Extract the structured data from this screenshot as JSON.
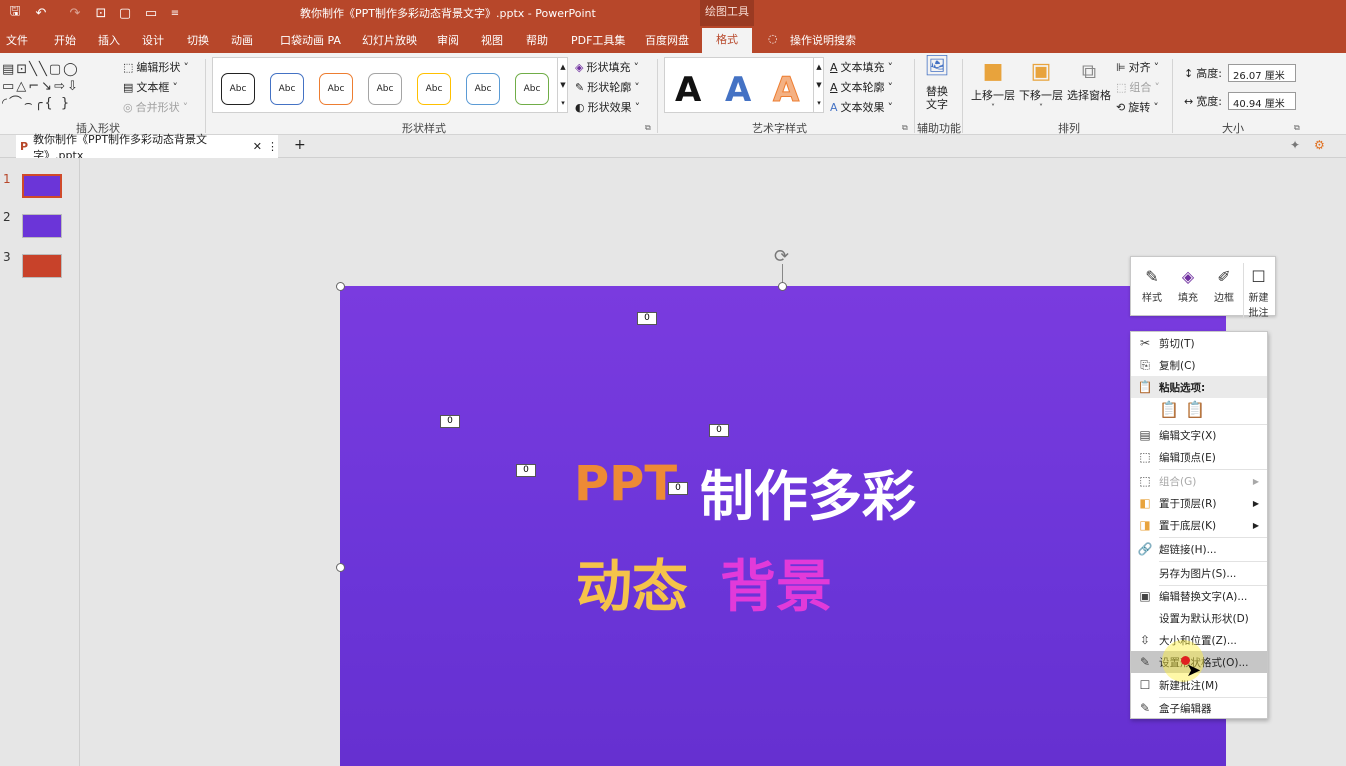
{
  "app": {
    "title": "教你制作《PPT制作多彩动态背景文字》.pptx  -  PowerPoint",
    "context_tools": "绘图工具",
    "accent": "#b7472a"
  },
  "tabs": [
    "文件",
    "开始",
    "插入",
    "设计",
    "切换",
    "动画",
    "口袋动画 PA",
    "幻灯片放映",
    "审阅",
    "视图",
    "帮助",
    "PDF工具集",
    "百度网盘",
    "格式"
  ],
  "active_tab": "格式",
  "tell_me": "操作说明搜索",
  "ribbon": {
    "insert_shapes": {
      "label": "插入形状",
      "edit_shape": "编辑形状",
      "text_box": "文本框",
      "merge_shapes": "合并形状"
    },
    "shape_styles": {
      "label": "形状样式",
      "sample": "Abc",
      "fill": "形状填充",
      "outline": "形状轮廓",
      "effects": "形状效果"
    },
    "wordart": {
      "label": "艺术字样式",
      "letter": "A",
      "text_fill": "文本填充",
      "text_outline": "文本轮廓",
      "text_effects": "文本效果"
    },
    "accessibility": {
      "label": "辅助功能",
      "alt_text": "替换\n文字",
      "alt_text_1": "替换",
      "alt_text_2": "文字"
    },
    "arrange": {
      "label": "排列",
      "bring_forward": "上移一层",
      "send_backward": "下移一层",
      "selection_pane": "选择窗格",
      "align": "对齐",
      "group": "组合",
      "rotate": "旋转"
    },
    "size": {
      "label": "大小",
      "height_label": "高度:",
      "height": "26.07 厘米",
      "width_label": "宽度:",
      "width": "40.94 厘米"
    }
  },
  "doc_tab": {
    "name": "教你制作《PPT制作多彩动态背景文字》.pptx"
  },
  "thumbnails": [
    {
      "num": "1"
    },
    {
      "num": "2"
    },
    {
      "num": "3"
    }
  ],
  "slide": {
    "line1_a": "PPT",
    "line1_b": "制作多彩",
    "line2_a": "动态",
    "line2_b": "背景",
    "markers": [
      "0",
      "0",
      "0",
      "0",
      "0"
    ]
  },
  "mini_toolbar": {
    "style": "样式",
    "fill": "填充",
    "border": "边框",
    "new_comment_1": "新建",
    "new_comment_2": "批注"
  },
  "context_menu": [
    {
      "label": "剪切(T)",
      "icon": "scissors-icon"
    },
    {
      "label": "复制(C)",
      "icon": "copy-icon"
    },
    {
      "label": "粘贴选项:",
      "icon": "paste-icon"
    },
    {
      "label": "编辑文字(X)",
      "icon": "edit-text-icon"
    },
    {
      "label": "编辑顶点(E)",
      "icon": "edit-points-icon"
    },
    {
      "label": "组合(G)",
      "icon": "group-icon"
    },
    {
      "label": "置于顶层(R)",
      "icon": "bring-front-icon"
    },
    {
      "label": "置于底层(K)",
      "icon": "send-back-icon"
    },
    {
      "label": "超链接(H)...",
      "icon": "link-icon"
    },
    {
      "label": "另存为图片(S)...",
      "icon": ""
    },
    {
      "label": "编辑替换文字(A)...",
      "icon": "alt-text-icon"
    },
    {
      "label": "设置为默认形状(D)",
      "icon": ""
    },
    {
      "label": "大小和位置(Z)...",
      "icon": "size-icon"
    },
    {
      "label": "设置形状格式(O)...",
      "icon": "format-shape-icon"
    },
    {
      "label": "新建批注(M)",
      "icon": "comment-icon"
    },
    {
      "label": "盒子编辑器",
      "icon": "box-editor-icon"
    }
  ]
}
